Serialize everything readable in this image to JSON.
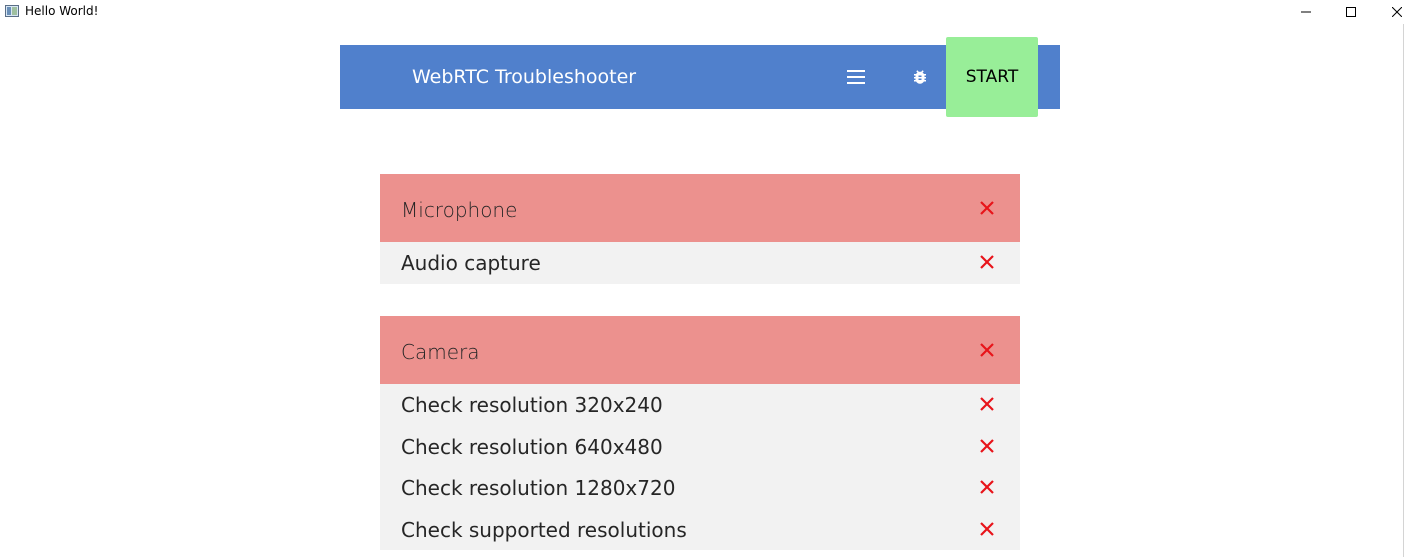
{
  "window": {
    "title": "Hello World!",
    "icon": "app-window-icon",
    "controls": [
      "minimize-icon",
      "maximize-icon",
      "close-icon"
    ]
  },
  "header": {
    "title": "WebRTC Troubleshooter",
    "menu_icon": "menu-icon",
    "bug_icon": "bug-icon",
    "start_label": "START",
    "colors": {
      "bar": "#5080cc",
      "start": "#98ee98"
    }
  },
  "panels": [
    {
      "title": "Microphone",
      "status": "failed",
      "tests": [
        {
          "label": "Audio capture",
          "status": "failed"
        }
      ]
    },
    {
      "title": "Camera",
      "status": "failed",
      "tests": [
        {
          "label": "Check resolution 320x240",
          "status": "failed"
        },
        {
          "label": "Check resolution 640x480",
          "status": "failed"
        },
        {
          "label": "Check resolution 1280x720",
          "status": "failed"
        },
        {
          "label": "Check supported resolutions",
          "status": "failed"
        }
      ]
    }
  ],
  "colors": {
    "failed_header": "#ec918e",
    "failed_icon": "#e8141a",
    "row_background": "#f2f2f2"
  }
}
